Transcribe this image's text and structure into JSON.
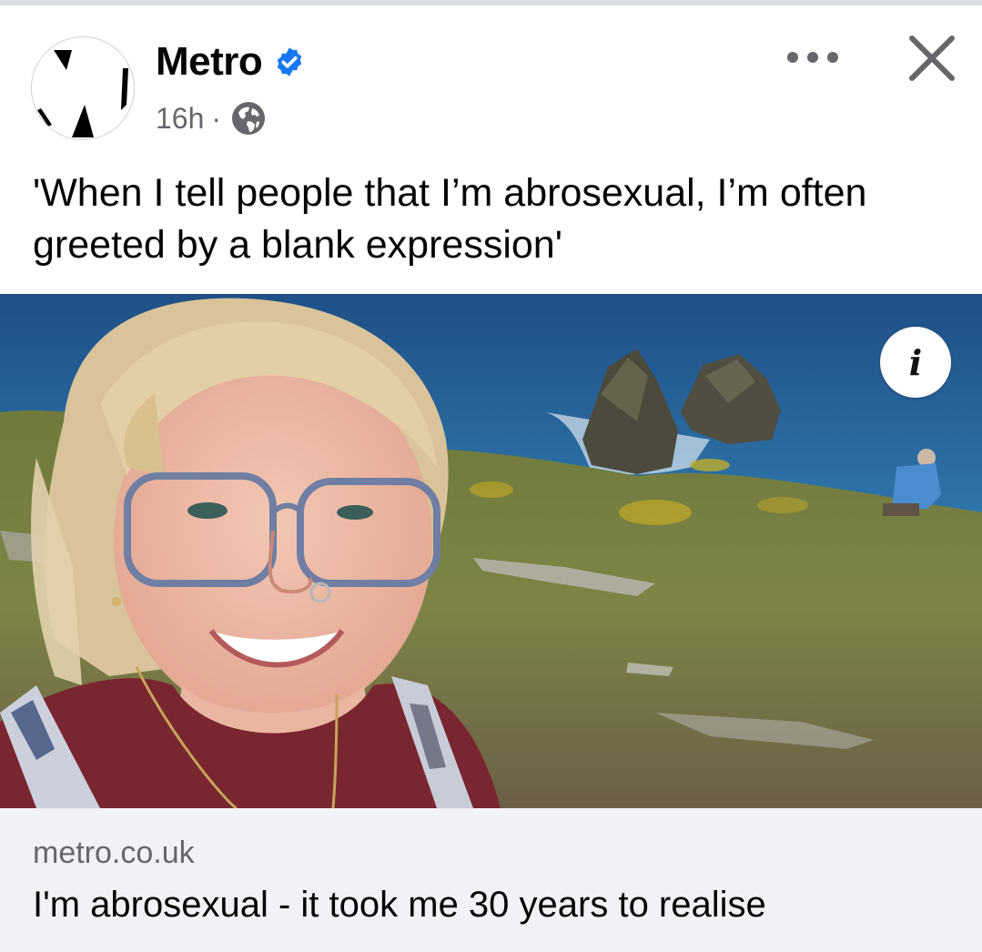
{
  "post": {
    "page_name": "Metro",
    "verified_icon": "verified-badge-icon",
    "time": "16h",
    "separator": "·",
    "audience_icon": "globe-icon",
    "text": "'When I tell people that I’m abrosexual, I’m often greeted by a blank expression'"
  },
  "actions": {
    "more_icon": "more-options-icon",
    "close_icon": "close-icon"
  },
  "media": {
    "info_label": "i"
  },
  "link": {
    "domain": "metro.co.uk",
    "title": "I'm abrosexual - it took me 30 years to realise"
  },
  "colors": {
    "verified": "#1877f2",
    "secondary_text": "#65676b",
    "link_card_bg": "#f0f2f5"
  }
}
